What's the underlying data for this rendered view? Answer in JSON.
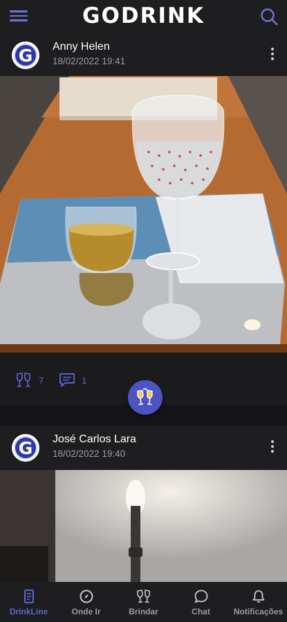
{
  "app": {
    "brand": "GODRINK"
  },
  "colors": {
    "accent": "#5d65d4",
    "background": "#1b1b1d",
    "bar": "#1e1e20"
  },
  "header": {
    "menu_icon": "hamburger-menu-icon",
    "search_icon": "search-icon"
  },
  "posts": [
    {
      "avatar_letter": "G",
      "author": "Anny Helen",
      "date": "18/02/2022 19:41",
      "image": "two glasses (whiskey and sparkling wine) on a mirrored tray on a wooden table",
      "cheers_count": "7",
      "comments_count": "1"
    },
    {
      "avatar_letter": "G",
      "author": "José Carlos Lara",
      "date": "18/02/2022 19:40",
      "image": "wall sconce light on a grey wall"
    }
  ],
  "nav": [
    {
      "label": "DrinkLine",
      "icon": "feed-icon",
      "active": true
    },
    {
      "label": "Onde Ir",
      "icon": "compass-icon",
      "active": false
    },
    {
      "label": "Brindar",
      "icon": "toast-glasses-icon",
      "active": false
    },
    {
      "label": "Chat",
      "icon": "chat-bubble-icon",
      "active": false
    },
    {
      "label": "Notificações",
      "icon": "bell-icon",
      "active": false
    }
  ]
}
